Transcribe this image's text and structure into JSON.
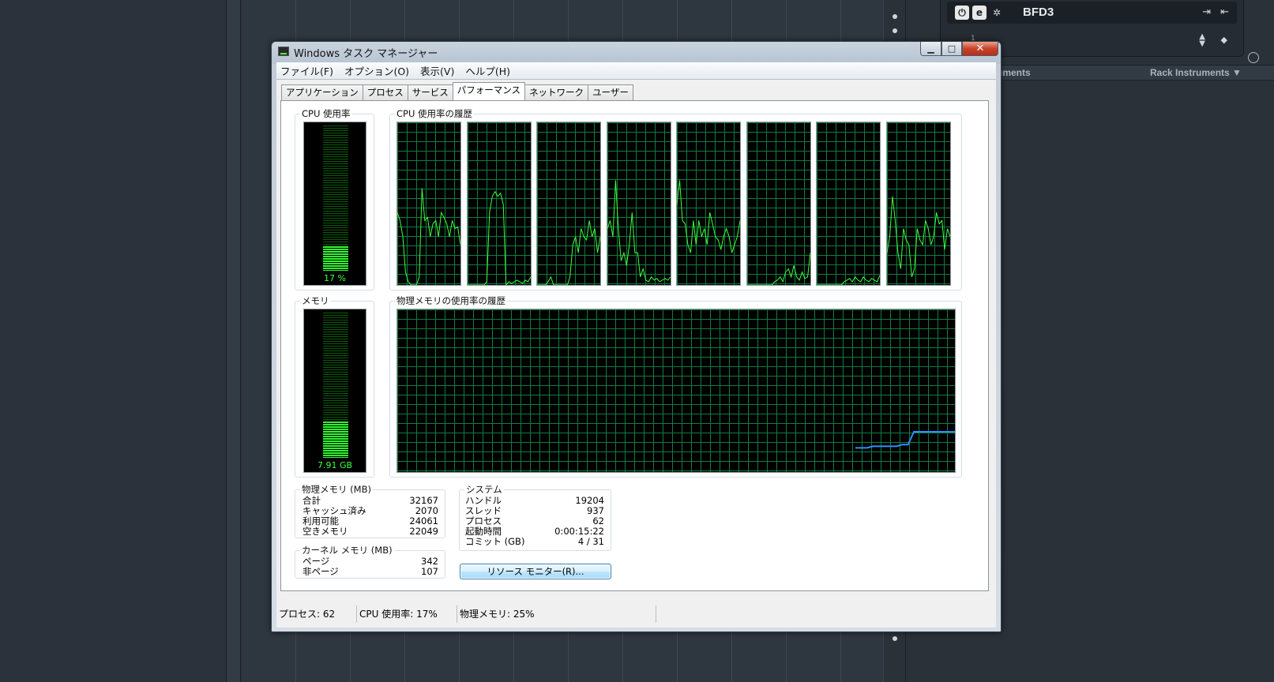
{
  "window": {
    "title": "Windows タスク マネージャー",
    "controls": {
      "minimize": "▁",
      "maximize": "□",
      "close": "✕"
    }
  },
  "menu": [
    "ファイル(F)",
    "オプション(O)",
    "表示(V)",
    "ヘルプ(H)"
  ],
  "tabs": [
    "アプリケーション",
    "プロセス",
    "サービス",
    "パフォーマンス",
    "ネットワーク",
    "ユーザー"
  ],
  "active_tab": "パフォーマンス",
  "cpu": {
    "group_label": "CPU 使用率",
    "value_text": "17 %",
    "usage_fraction": 0.17,
    "history_label": "CPU 使用率の履歴"
  },
  "memory": {
    "group_label": "メモリ",
    "value_text": "7.91 GB",
    "usage_fraction": 0.25,
    "history_label": "物理メモリの使用率の履歴"
  },
  "physical_memory": {
    "label": "物理メモリ (MB)",
    "rows": [
      {
        "key": "合計",
        "value": "32167"
      },
      {
        "key": "キャッシュ済み",
        "value": "2070"
      },
      {
        "key": "利用可能",
        "value": "24061"
      },
      {
        "key": "空きメモリ",
        "value": "22049"
      }
    ]
  },
  "kernel_memory": {
    "label": "カーネル メモリ (MB)",
    "rows": [
      {
        "key": "ページ",
        "value": "342"
      },
      {
        "key": "非ページ",
        "value": "107"
      }
    ]
  },
  "system": {
    "label": "システム",
    "rows": [
      {
        "key": "ハンドル",
        "value": "19204"
      },
      {
        "key": "スレッド",
        "value": "937"
      },
      {
        "key": "プロセス",
        "value": "62"
      },
      {
        "key": "起動時間",
        "value": "0:00:15:22"
      },
      {
        "key": "コミット (GB)",
        "value": "4 / 31"
      }
    ]
  },
  "resource_monitor_button": "リソース モニター(R)...",
  "statusbar": {
    "processes": "プロセス: 62",
    "cpu": "CPU 使用率: 17%",
    "memory": "物理メモリ: 25%"
  },
  "cpu_history": [
    [
      45,
      40,
      30,
      8,
      2,
      0,
      0,
      0,
      5,
      60,
      40,
      42,
      30,
      38,
      40,
      30,
      45,
      42,
      38,
      30,
      40,
      35,
      36,
      25
    ],
    [
      0,
      0,
      0,
      0,
      0,
      0,
      0,
      2,
      45,
      55,
      58,
      55,
      57,
      50,
      0,
      2,
      1,
      2,
      3,
      2,
      1,
      3,
      2,
      5
    ],
    [
      0,
      0,
      0,
      0,
      2,
      5,
      0,
      0,
      0,
      0,
      0,
      0,
      5,
      25,
      30,
      20,
      35,
      30,
      28,
      40,
      30,
      35,
      20,
      30
    ],
    [
      35,
      40,
      30,
      65,
      35,
      15,
      20,
      12,
      25,
      45,
      20,
      20,
      5,
      10,
      3,
      2,
      5,
      3,
      4,
      2,
      3,
      4,
      3,
      5
    ],
    [
      50,
      65,
      40,
      38,
      25,
      20,
      40,
      25,
      40,
      30,
      35,
      25,
      45,
      38,
      30,
      28,
      22,
      30,
      35,
      30,
      20,
      25,
      30,
      40
    ],
    [
      0,
      0,
      0,
      0,
      0,
      0,
      0,
      0,
      0,
      0,
      2,
      3,
      5,
      2,
      8,
      10,
      5,
      12,
      5,
      3,
      8,
      4,
      5,
      20
    ],
    [
      0,
      0,
      0,
      0,
      0,
      0,
      0,
      0,
      0,
      0,
      2,
      3,
      4,
      2,
      5,
      3,
      2,
      5,
      3,
      2,
      4,
      3,
      2,
      6
    ],
    [
      20,
      30,
      55,
      40,
      20,
      10,
      35,
      28,
      25,
      5,
      10,
      35,
      28,
      25,
      40,
      35,
      25,
      30,
      45,
      38,
      40,
      22,
      35,
      30
    ]
  ],
  "memory_history": [
    15,
    15,
    15,
    16,
    16,
    16,
    16,
    16,
    17,
    17,
    25,
    25,
    25,
    25,
    25,
    25,
    25,
    25
  ],
  "colors": {
    "graph_line": "#3cff3c",
    "memory_line": "#2f8fff",
    "grid": "#0f7d40",
    "meter_fill": "#2fff2f"
  },
  "background_app": {
    "instrument_name": "BFD3",
    "instrument_icons": [
      "power-icon",
      "edit-icon",
      "settings-icon"
    ],
    "instrument_sub": "1",
    "rack_left_label": "uments",
    "rack_right_label": "Rack Instruments ▼"
  }
}
